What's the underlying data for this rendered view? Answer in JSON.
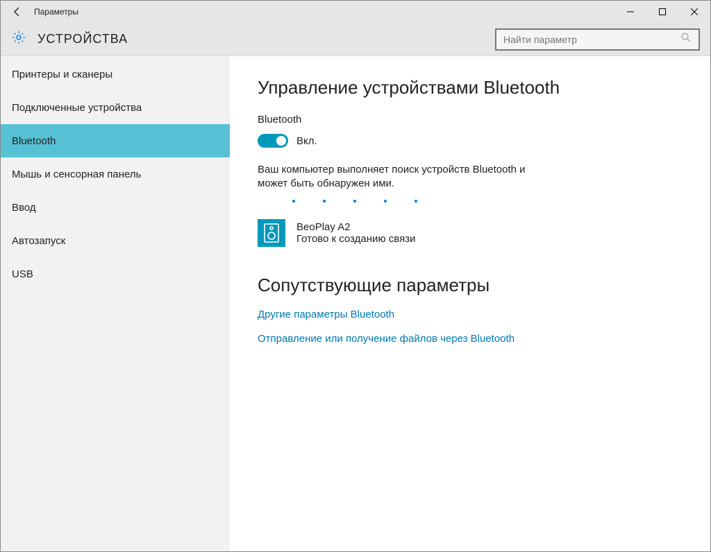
{
  "titlebar": {
    "title": "Параметры"
  },
  "header": {
    "section": "УСТРОЙСТВА",
    "search_placeholder": "Найти параметр"
  },
  "sidebar": {
    "items": [
      {
        "label": "Принтеры и сканеры"
      },
      {
        "label": "Подключенные устройства"
      },
      {
        "label": "Bluetooth"
      },
      {
        "label": "Мышь и сенсорная панель"
      },
      {
        "label": "Ввод"
      },
      {
        "label": "Автозапуск"
      },
      {
        "label": "USB"
      }
    ]
  },
  "main": {
    "heading": "Управление устройствами Bluetooth",
    "toggle_label": "Bluetooth",
    "toggle_state": "Вкл.",
    "info_text": "Ваш компьютер выполняет поиск устройств Bluetooth и может быть обнаружен ими.",
    "device": {
      "name": "BeoPlay A2",
      "status": "Готово к созданию связи"
    },
    "related_heading": "Сопутствующие параметры",
    "links": [
      "Другие параметры Bluetooth",
      "Отправление или получение файлов через Bluetooth"
    ]
  }
}
